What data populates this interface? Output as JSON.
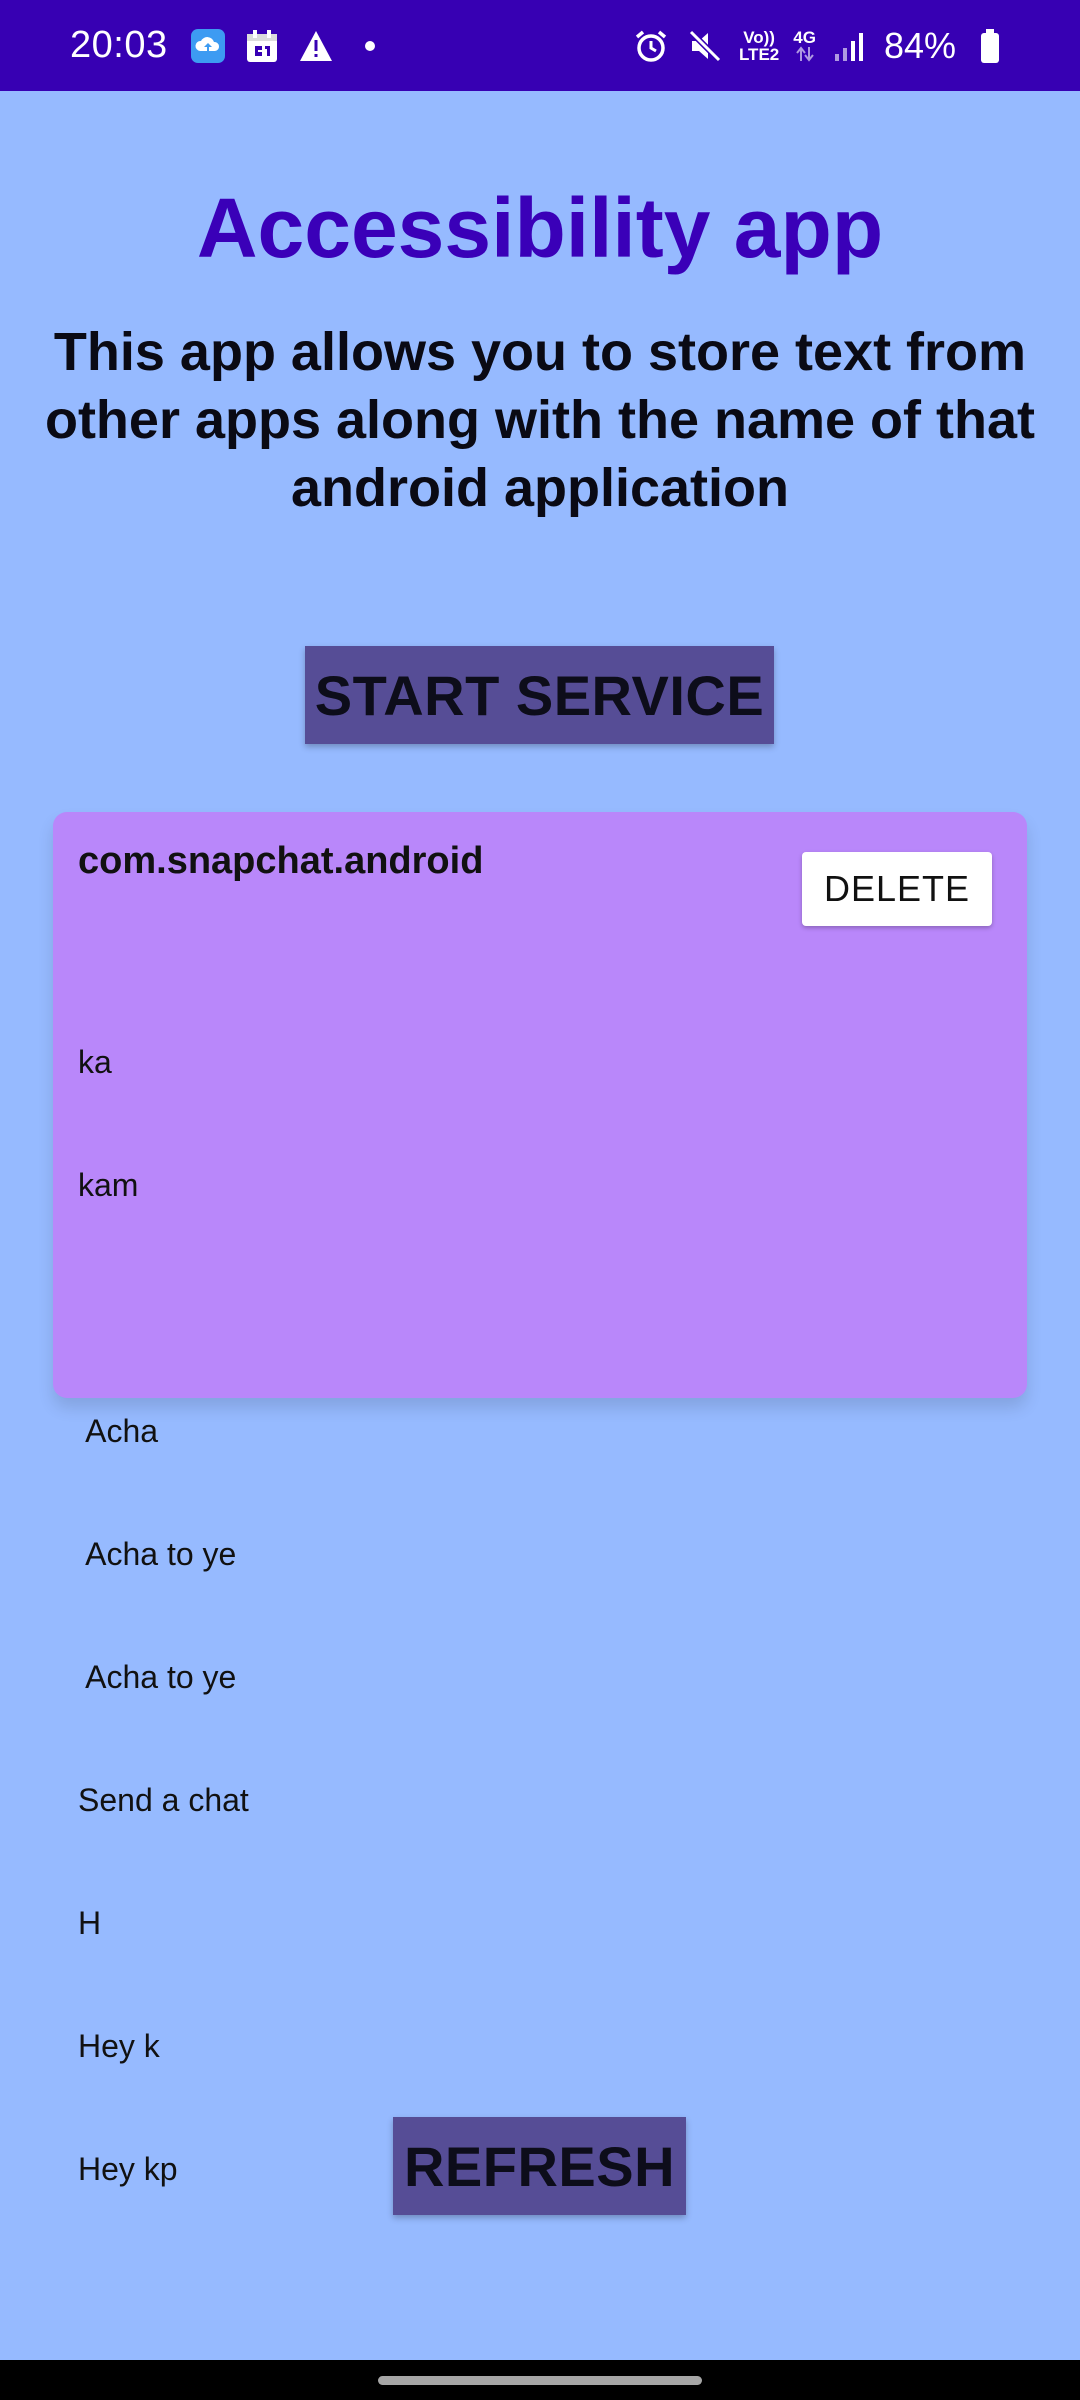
{
  "status_bar": {
    "time": "20:03",
    "battery_percent": "84%",
    "volte_top": "Vo))",
    "volte_bottom": "LTE2",
    "network_type": "4G",
    "left_icons": [
      "cloud-upload-icon",
      "calendar-icon",
      "warning-icon",
      "dot-icon"
    ],
    "right_icons": [
      "alarm-icon",
      "mute-icon",
      "volte-icon",
      "network-4g-icon",
      "signal-icon",
      "battery-icon"
    ]
  },
  "app": {
    "title": "Accessibility app",
    "description": "This app allows you to store text from other apps along with the name of that android application"
  },
  "buttons": {
    "start_service": "START SERVICE",
    "refresh": "REFRESH"
  },
  "entries": [
    {
      "app_name": "com.snapchat.android",
      "delete_label": "DELETE",
      "lines": [
        "ka",
        "kam",
        "",
        " Acha",
        " Acha to ye",
        " Acha to ye",
        "Send a chat",
        "H",
        "Hey k",
        "Hey kp"
      ]
    }
  ],
  "colors": {
    "status_bar": "#3700b3",
    "background": "#96baff",
    "title": "#3a00b8",
    "primary_button": "#564d96",
    "card": "#b987fa"
  }
}
